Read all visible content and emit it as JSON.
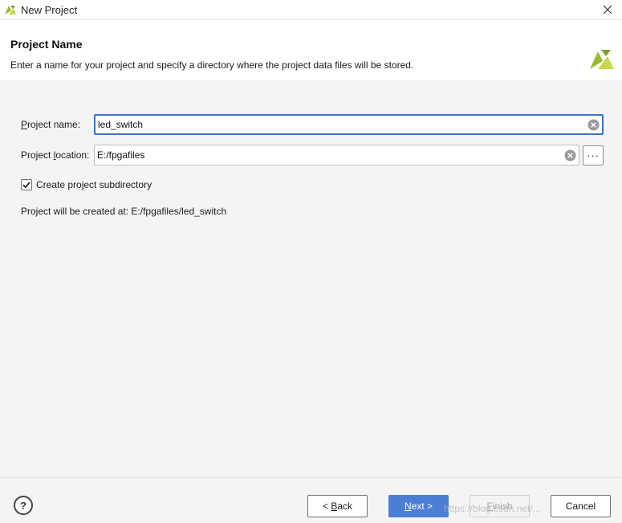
{
  "window": {
    "title": "New Project",
    "accent_color": "#3c72c4",
    "logo_colors": [
      "#9bbb2f",
      "#c9d84a"
    ]
  },
  "header": {
    "title": "Project Name",
    "description": "Enter a name for your project and specify a directory where the project data files will be stored."
  },
  "form": {
    "project_name": {
      "label_first": "P",
      "label_rest": "roject name:",
      "value": "led_switch"
    },
    "project_location": {
      "label_before": "Project ",
      "label_underlined": "l",
      "label_after": "ocation:",
      "value": "E:/fpgafiles",
      "browse_label": "···"
    },
    "subdirectory": {
      "label": "Create project subdirectory",
      "checked": true
    },
    "created_at": "Project will be created at: E:/fpgafiles/led_switch"
  },
  "footer": {
    "help_label": "?",
    "back_prefix": "< ",
    "back_underlined": "B",
    "back_rest": "ack",
    "next_underlined": "N",
    "next_rest": "ext >",
    "finish_underlined": "F",
    "finish_rest": "inish",
    "cancel_label": "Cancel",
    "watermark": "https://blog.csdn.net/..."
  }
}
